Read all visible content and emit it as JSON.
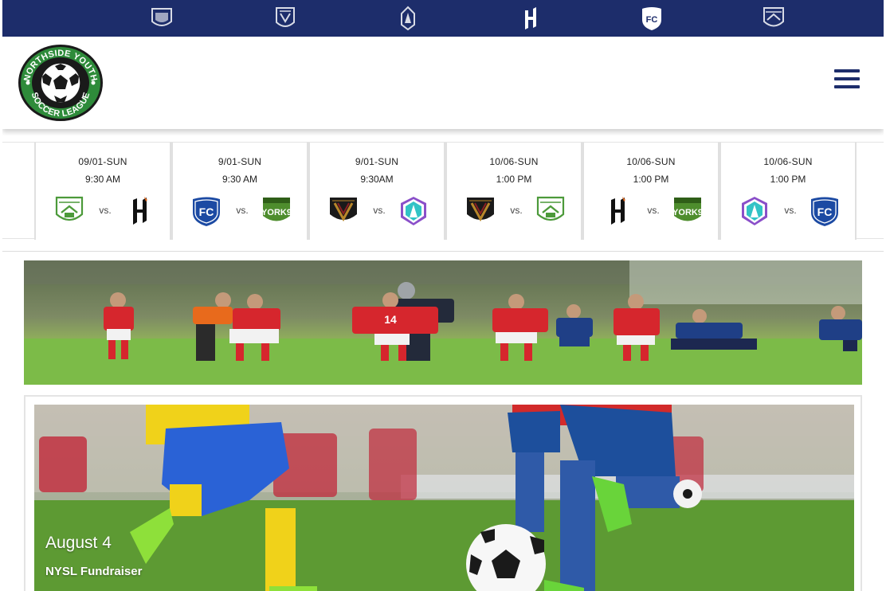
{
  "club_bar": {
    "icons": [
      {
        "name": "york-crest-icon"
      },
      {
        "name": "pacific-crest-icon"
      },
      {
        "name": "atletico-crest-icon"
      },
      {
        "name": "forge-crest-icon"
      },
      {
        "name": "fc-edmonton-crest-icon"
      },
      {
        "name": "cavalry-crest-icon"
      }
    ]
  },
  "logo": {
    "line1": "NORTHSIDE YOUTH",
    "line2": "SOCCER LEAGUE"
  },
  "schedule": {
    "vs_label": "vs.",
    "games": [
      {
        "date": "09/01-SUN",
        "time": "9:30 AM",
        "home": "cavalry",
        "away": "forge"
      },
      {
        "date": "9/01-SUN",
        "time": "9:30 AM",
        "home": "fc-edmonton",
        "away": "york9"
      },
      {
        "date": "9/01-SUN",
        "time": "9:30AM",
        "home": "valour",
        "away": "atletico"
      },
      {
        "date": "10/06-SUN",
        "time": "1:00 PM",
        "home": "valour",
        "away": "cavalry"
      },
      {
        "date": "10/06-SUN",
        "time": "1:00 PM",
        "home": "forge",
        "away": "york9"
      },
      {
        "date": "10/06-SUN",
        "time": "1:00 PM",
        "home": "atletico",
        "away": "fc-edmonton"
      }
    ]
  },
  "banner": {
    "jersey_number": "14"
  },
  "event": {
    "date": "August 4",
    "title": "NYSL Fundraiser"
  },
  "colors": {
    "navy": "#1d2d6b",
    "logo_green": "#2e8b3a",
    "cavalry_green": "#4c9a3a",
    "york_green": "#4e8d2d",
    "fc_blue": "#1c4aa3",
    "valour_black": "#1a1a1a",
    "atletico_purple": "#8a4fc9"
  }
}
